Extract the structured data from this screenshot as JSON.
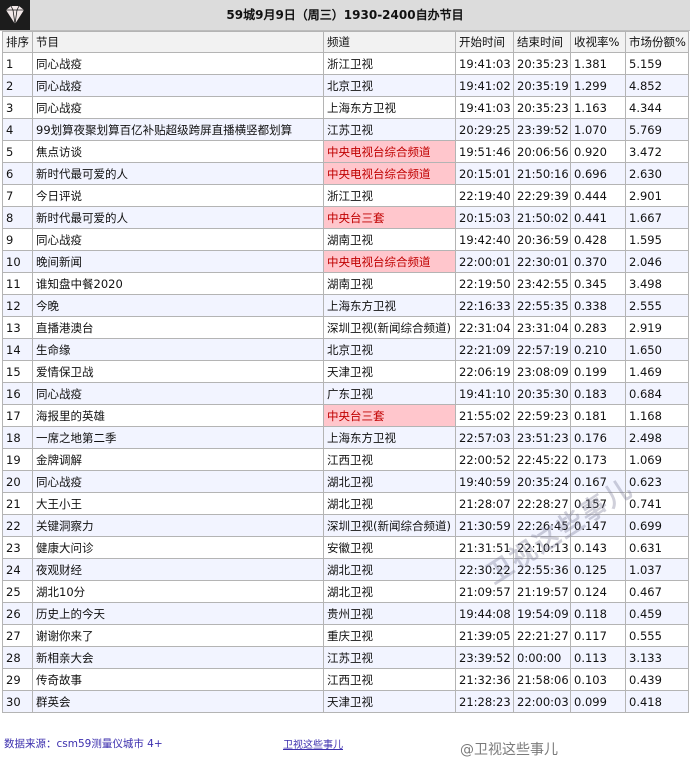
{
  "title": "59城9月9日（周三）1930-2400自办节目",
  "headers": [
    "排序",
    "节目",
    "频道",
    "开始时间",
    "结束时间",
    "收视率%",
    "市场份额%"
  ],
  "rows": [
    {
      "rank": "1",
      "program": "同心战疫",
      "channel": "浙江卫视",
      "start": "19:41:03",
      "end": "20:35:23",
      "rating": "1.381",
      "share": "5.159",
      "hl": false
    },
    {
      "rank": "2",
      "program": "同心战疫",
      "channel": "北京卫视",
      "start": "19:41:02",
      "end": "20:35:19",
      "rating": "1.299",
      "share": "4.852",
      "hl": false
    },
    {
      "rank": "3",
      "program": "同心战疫",
      "channel": "上海东方卫视",
      "start": "19:41:03",
      "end": "20:35:23",
      "rating": "1.163",
      "share": "4.344",
      "hl": false
    },
    {
      "rank": "4",
      "program": "99划算夜聚划算百亿补贴超级跨屏直播横竖都划算",
      "channel": "江苏卫视",
      "start": "20:29:25",
      "end": "23:39:52",
      "rating": "1.070",
      "share": "5.769",
      "hl": false
    },
    {
      "rank": "5",
      "program": "焦点访谈",
      "channel": "中央电视台综合频道",
      "start": "19:51:46",
      "end": "20:06:56",
      "rating": "0.920",
      "share": "3.472",
      "hl": true
    },
    {
      "rank": "6",
      "program": "新时代最可爱的人",
      "channel": "中央电视台综合频道",
      "start": "20:15:01",
      "end": "21:50:16",
      "rating": "0.696",
      "share": "2.630",
      "hl": true
    },
    {
      "rank": "7",
      "program": "今日评说",
      "channel": "浙江卫视",
      "start": "22:19:40",
      "end": "22:29:39",
      "rating": "0.444",
      "share": "2.901",
      "hl": false
    },
    {
      "rank": "8",
      "program": "新时代最可爱的人",
      "channel": "中央台三套",
      "start": "20:15:03",
      "end": "21:50:02",
      "rating": "0.441",
      "share": "1.667",
      "hl": true
    },
    {
      "rank": "9",
      "program": "同心战疫",
      "channel": "湖南卫视",
      "start": "19:42:40",
      "end": "20:36:59",
      "rating": "0.428",
      "share": "1.595",
      "hl": false
    },
    {
      "rank": "10",
      "program": "晚间新闻",
      "channel": "中央电视台综合频道",
      "start": "22:00:01",
      "end": "22:30:01",
      "rating": "0.370",
      "share": "2.046",
      "hl": true
    },
    {
      "rank": "11",
      "program": "谁知盘中餐2020",
      "channel": "湖南卫视",
      "start": "22:19:50",
      "end": "23:42:55",
      "rating": "0.345",
      "share": "3.498",
      "hl": false
    },
    {
      "rank": "12",
      "program": "今晚",
      "channel": "上海东方卫视",
      "start": "22:16:33",
      "end": "22:55:35",
      "rating": "0.338",
      "share": "2.555",
      "hl": false
    },
    {
      "rank": "13",
      "program": "直播港澳台",
      "channel": "深圳卫视(新闻综合频道)",
      "start": "22:31:04",
      "end": "23:31:04",
      "rating": "0.283",
      "share": "2.919",
      "hl": false
    },
    {
      "rank": "14",
      "program": "生命缘",
      "channel": "北京卫视",
      "start": "22:21:09",
      "end": "22:57:19",
      "rating": "0.210",
      "share": "1.650",
      "hl": false
    },
    {
      "rank": "15",
      "program": "爱情保卫战",
      "channel": "天津卫视",
      "start": "22:06:19",
      "end": "23:08:09",
      "rating": "0.199",
      "share": "1.469",
      "hl": false
    },
    {
      "rank": "16",
      "program": "同心战疫",
      "channel": "广东卫视",
      "start": "19:41:10",
      "end": "20:35:30",
      "rating": "0.183",
      "share": "0.684",
      "hl": false
    },
    {
      "rank": "17",
      "program": "海报里的英雄",
      "channel": "中央台三套",
      "start": "21:55:02",
      "end": "22:59:23",
      "rating": "0.181",
      "share": "1.168",
      "hl": true
    },
    {
      "rank": "18",
      "program": "一席之地第二季",
      "channel": "上海东方卫视",
      "start": "22:57:03",
      "end": "23:51:23",
      "rating": "0.176",
      "share": "2.498",
      "hl": false
    },
    {
      "rank": "19",
      "program": "金牌调解",
      "channel": "江西卫视",
      "start": "22:00:52",
      "end": "22:45:22",
      "rating": "0.173",
      "share": "1.069",
      "hl": false
    },
    {
      "rank": "20",
      "program": "同心战疫",
      "channel": "湖北卫视",
      "start": "19:40:59",
      "end": "20:35:24",
      "rating": "0.167",
      "share": "0.623",
      "hl": false
    },
    {
      "rank": "21",
      "program": "大王小王",
      "channel": "湖北卫视",
      "start": "21:28:07",
      "end": "22:28:27",
      "rating": "0.157",
      "share": "0.741",
      "hl": false
    },
    {
      "rank": "22",
      "program": "关键洞察力",
      "channel": "深圳卫视(新闻综合频道)",
      "start": "21:30:59",
      "end": "22:26:45",
      "rating": "0.147",
      "share": "0.699",
      "hl": false
    },
    {
      "rank": "23",
      "program": "健康大问诊",
      "channel": "安徽卫视",
      "start": "21:31:51",
      "end": "22:10:13",
      "rating": "0.143",
      "share": "0.631",
      "hl": false
    },
    {
      "rank": "24",
      "program": "夜观财经",
      "channel": "湖北卫视",
      "start": "22:30:22",
      "end": "22:55:36",
      "rating": "0.125",
      "share": "1.037",
      "hl": false
    },
    {
      "rank": "25",
      "program": "湖北10分",
      "channel": "湖北卫视",
      "start": "21:09:57",
      "end": "21:19:57",
      "rating": "0.124",
      "share": "0.467",
      "hl": false
    },
    {
      "rank": "26",
      "program": "历史上的今天",
      "channel": "贵州卫视",
      "start": "19:44:08",
      "end": "19:54:09",
      "rating": "0.118",
      "share": "0.459",
      "hl": false
    },
    {
      "rank": "27",
      "program": "谢谢你来了",
      "channel": "重庆卫视",
      "start": "21:39:05",
      "end": "22:21:27",
      "rating": "0.117",
      "share": "0.555",
      "hl": false
    },
    {
      "rank": "28",
      "program": "新相亲大会",
      "channel": "江苏卫视",
      "start": "23:39:52",
      "end": "0:00:00",
      "rating": "0.113",
      "share": "3.133",
      "hl": false
    },
    {
      "rank": "29",
      "program": "传奇故事",
      "channel": "江西卫视",
      "start": "21:32:36",
      "end": "21:58:06",
      "rating": "0.103",
      "share": "0.439",
      "hl": false
    },
    {
      "rank": "30",
      "program": "群英会",
      "channel": "天津卫视",
      "start": "21:28:23",
      "end": "22:00:03",
      "rating": "0.099",
      "share": "0.418",
      "hl": false
    }
  ],
  "footer": {
    "source": "数据来源：csm59测量仪城市 4+",
    "mid": "卫视这些事儿",
    "weibo": "@卫视这些事儿",
    "watermark": "卫视这些事儿"
  },
  "colors": {
    "highlight_bg": "#ffc6cc",
    "highlight_text": "#c00000",
    "stripe": "#f2f4ff",
    "footer_text": "#3c2fae"
  }
}
